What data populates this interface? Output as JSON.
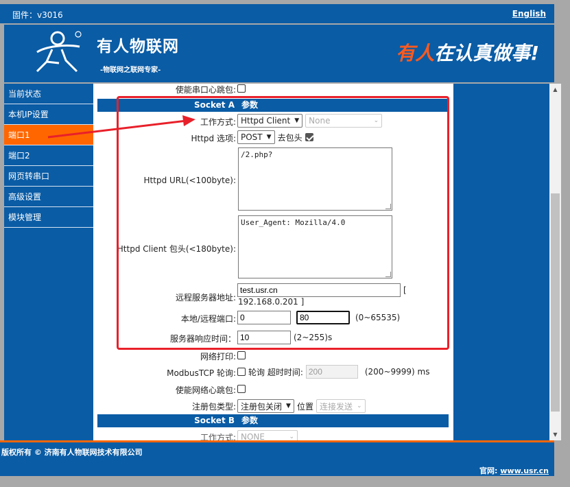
{
  "topbar": {
    "firmware": "固件：v3016",
    "language_link": "English"
  },
  "banner": {
    "brand": "有人物联网",
    "brand_sub": "-物联网之联网专家-",
    "slogan_red": "有人",
    "slogan_white": "在认真做事!"
  },
  "sidebar": {
    "items": [
      {
        "label": "当前状态"
      },
      {
        "label": "本机IP设置"
      },
      {
        "label": "端口1"
      },
      {
        "label": "端口2"
      },
      {
        "label": "网页转串口"
      },
      {
        "label": "高级设置"
      },
      {
        "label": "模块管理"
      }
    ],
    "active_index": 2
  },
  "form": {
    "serial_heartbeat_label": "使能串口心跳包:",
    "socket_a_title": "Socket A",
    "socket_a_suffix": "参数",
    "work_mode_label": "工作方式:",
    "work_mode_value": "Httpd Client",
    "work_mode_secondary": "None",
    "httpd_option_label": "Httpd 选项:",
    "httpd_method": "POST",
    "strip_header_label": "去包头",
    "httpd_url_label": "Httpd URL(<100byte):",
    "httpd_url_value": "/2.php?",
    "httpd_header_label": "Httpd Client 包头(<180byte):",
    "httpd_header_value": "User_Agent: Mozilla/4.0",
    "remote_server_label": "远程服务器地址:",
    "remote_server_value": "test.usr.cn",
    "remote_server_bracket_open": "[",
    "remote_server_ip": "192.168.0.201 ]",
    "port_label": "本地/远程端口:",
    "local_port": "0",
    "remote_port": "80",
    "port_range": "(0~65535)",
    "response_time_label": "服务器响应时间：",
    "response_time_value": "10",
    "response_time_range": "(2~255)s",
    "net_print_label": "网络打印:",
    "modbus_poll_label": "ModbusTCP 轮询:",
    "modbus_poll_text": "轮询 超时时间:",
    "modbus_timeout_value": "200",
    "modbus_timeout_range": "(200~9999) ms",
    "net_heartbeat_label": "使能网络心跳包:",
    "register_type_label": "注册包类型:",
    "register_type_value": "注册包关闭",
    "position_label": "位置",
    "position_value": "连接发送",
    "socket_b_title": "Socket B",
    "socket_b_suffix": "参数",
    "socket_b_mode_label": "工作方式:",
    "socket_b_mode_value": "NONE"
  },
  "footer": {
    "copyright": "版权所有 © 济南有人物联网技术有限公司",
    "site_label": "官网:",
    "site_link": "www.usr.cn"
  },
  "colors": {
    "brand_blue": "#0a5ca5",
    "accent_orange": "#ff6600",
    "highlight_red": "#e8202a"
  }
}
